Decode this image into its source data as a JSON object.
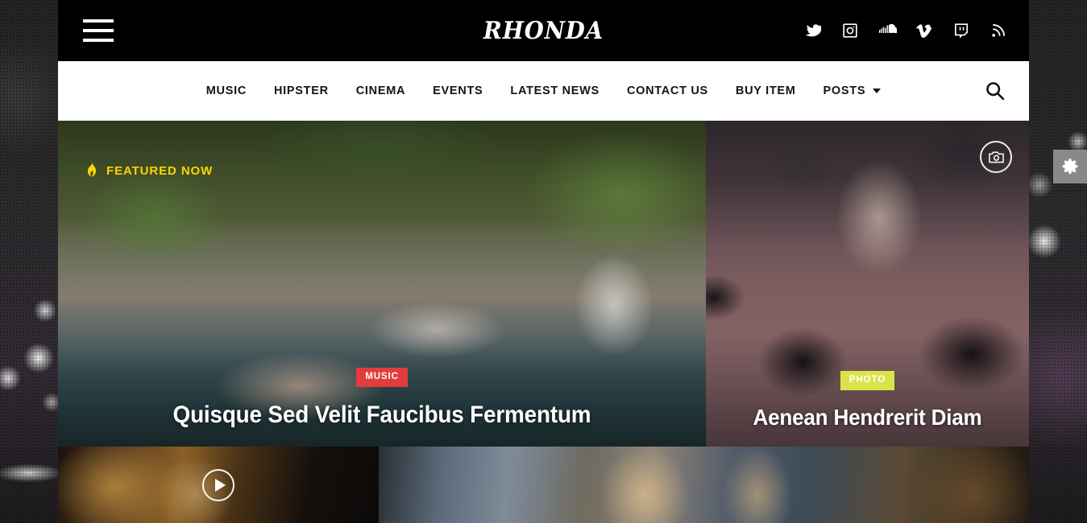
{
  "site": {
    "logo_text": "RHONDA"
  },
  "topbar": {
    "menu_icon": "hamburger-menu-icon",
    "socials": [
      {
        "name": "twitter-icon",
        "label": "Twitter"
      },
      {
        "name": "instagram-icon",
        "label": "Instagram"
      },
      {
        "name": "soundcloud-icon",
        "label": "SoundCloud"
      },
      {
        "name": "vimeo-icon",
        "label": "Vimeo"
      },
      {
        "name": "twitch-icon",
        "label": "Twitch"
      },
      {
        "name": "rss-icon",
        "label": "RSS"
      }
    ]
  },
  "nav": {
    "items": [
      {
        "label": "MUSIC",
        "has_dropdown": false
      },
      {
        "label": "HIPSTER",
        "has_dropdown": false
      },
      {
        "label": "CINEMA",
        "has_dropdown": false
      },
      {
        "label": "EVENTS",
        "has_dropdown": false
      },
      {
        "label": "LATEST NEWS",
        "has_dropdown": false
      },
      {
        "label": "CONTACT US",
        "has_dropdown": false
      },
      {
        "label": "BUY ITEM",
        "has_dropdown": false
      },
      {
        "label": "POSTS",
        "has_dropdown": true
      }
    ],
    "search_icon": "search-icon"
  },
  "hero": {
    "featured_label": "FEATURED NOW",
    "featured_icon": "flame-icon",
    "featured_color": "#ffd400",
    "main_card": {
      "category": "MUSIC",
      "category_color": "#e23c3c",
      "title": "Quisque Sed Velit Faucibus Fermentum"
    },
    "right_card": {
      "category": "PHOTO",
      "category_color": "#dbe34a",
      "title": "Aenean Hendrerit Diam",
      "format_icon": "camera-icon"
    },
    "bottom_left_card": {
      "format_icon": "play-icon"
    },
    "bottom_right_card": {
      "format_icon": ""
    }
  },
  "theme_options": {
    "icon": "gear-icon",
    "label": "Theme options"
  }
}
